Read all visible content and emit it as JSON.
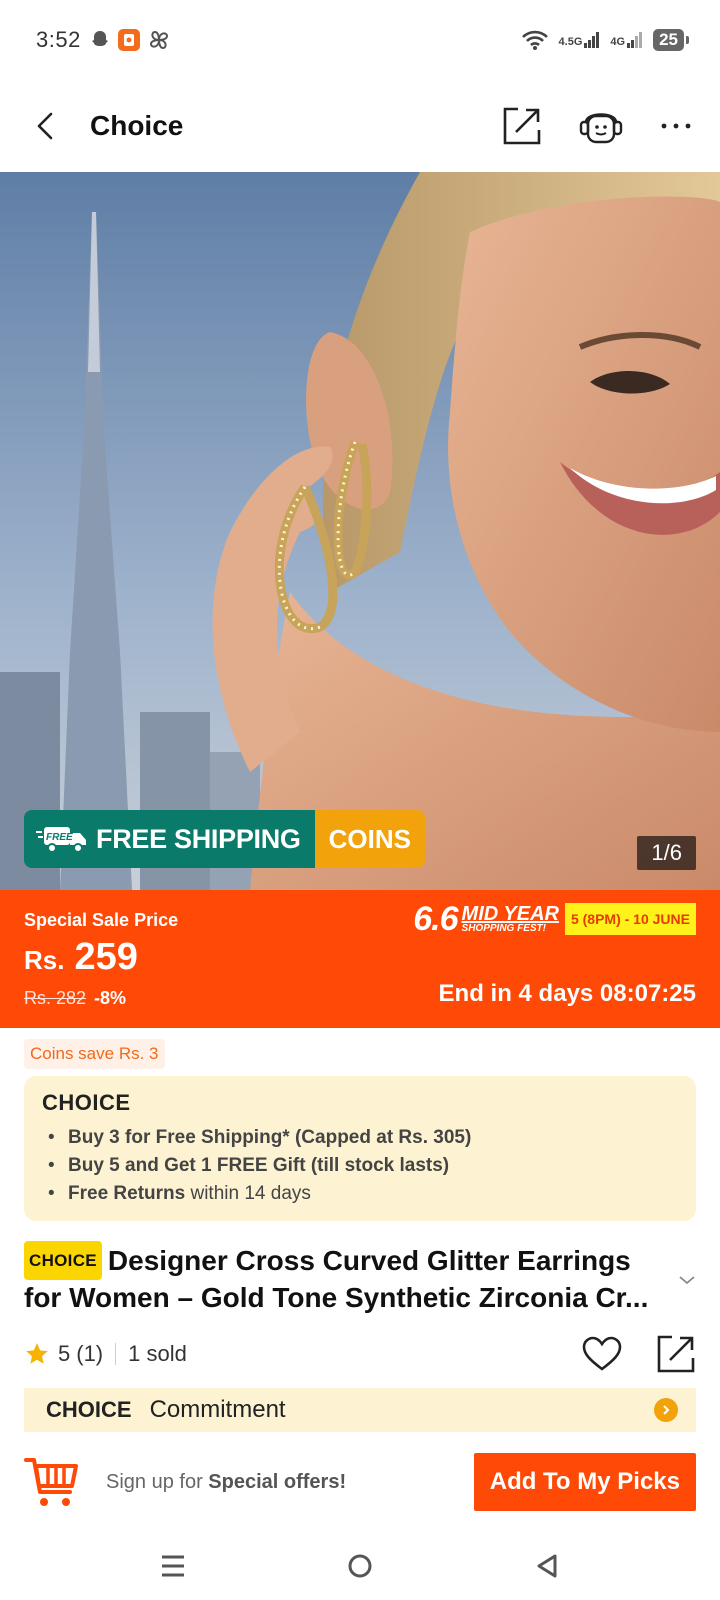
{
  "status": {
    "time": "3:52",
    "network1": "4.5G",
    "network2": "4G",
    "battery": "25"
  },
  "header": {
    "title": "Choice"
  },
  "hero": {
    "pager": "1/6",
    "shipping_label": "FREE SHIPPING",
    "shipping_badge": "FREE",
    "coins_label": "COINS"
  },
  "price": {
    "label": "Special Sale Price",
    "currency": "Rs.",
    "value": "259",
    "original": "Rs. 282",
    "discount": "-8%",
    "fest_big": "6.6",
    "fest_line1": "MID YEAR",
    "fest_line2": "SHOPPING FEST!",
    "fest_dates": "5 (8PM) - 10 JUNE",
    "countdown": "End in 4 days 08:07:25"
  },
  "coins_tag": "Coins save Rs. 3",
  "choice_box": {
    "logo": "CHOICE",
    "perks": [
      {
        "bold": "Buy 3 for  Free Shipping* (Capped at Rs. 305)",
        "rest": ""
      },
      {
        "bold": "Buy 5 and Get 1 FREE Gift (till stock lasts)",
        "rest": ""
      },
      {
        "bold": "Free Returns",
        "rest": " within 14 days"
      }
    ]
  },
  "product": {
    "badge": "CHOICE",
    "title": "Designer Cross Curved Glitter Earrings for Women – Gold Tone Synthetic Zirconia Cr..."
  },
  "rating": {
    "score": "5",
    "count": "(1)",
    "sold": "1 sold"
  },
  "commitment": {
    "logo": "CHOICE",
    "label": "Commitment"
  },
  "action_bar": {
    "signup_prefix": "Sign up for ",
    "signup_bold": "Special offers!",
    "cta": "Add To My Picks"
  },
  "colors": {
    "accent": "#fe4a06",
    "shipping_green": "#0a7b6a",
    "coins_orange": "#f2a20a",
    "choice_bg": "#fdf3d2",
    "choice_yellow": "#fbd500"
  },
  "icons": [
    "back-icon",
    "share-icon",
    "support-icon",
    "more-icon",
    "star-icon",
    "heart-icon",
    "cart-icon",
    "chevron-down-icon",
    "chevron-right-icon",
    "truck-icon",
    "menu-icon",
    "home-icon",
    "back-nav-icon"
  ]
}
